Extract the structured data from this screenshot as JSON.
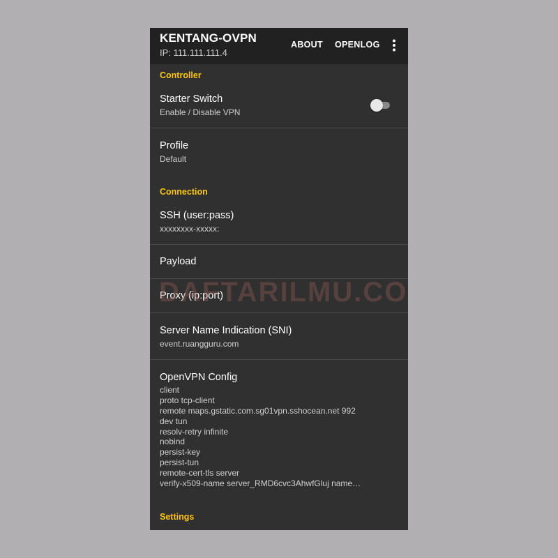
{
  "appbar": {
    "title": "KENTANG-OVPN",
    "subtitle": "IP: 111.111.111.4",
    "actions": {
      "about": "ABOUT",
      "openlog": "OPENLOG"
    },
    "overflow_icon": "more-vert-icon"
  },
  "sections": {
    "controller": "Controller",
    "connection": "Connection",
    "settings": "Settings"
  },
  "items": {
    "starter": {
      "label": "Starter Switch",
      "value": "Enable / Disable VPN",
      "enabled": false
    },
    "profile": {
      "label": "Profile",
      "value": "Default"
    },
    "ssh": {
      "label": "SSH (user:pass)",
      "value": "xxxxxxxx-xxxxx:"
    },
    "payload": {
      "label": "Payload"
    },
    "proxy": {
      "label": "Proxy (ip:port)"
    },
    "sni": {
      "label": "Server Name Indication (SNI)",
      "value": "event.ruangguru.com"
    },
    "openvpn": {
      "label": "OpenVPN Config",
      "lines": [
        "client",
        "proto tcp-client",
        "remote maps.gstatic.com.sg01vpn.sshocean.net 992",
        "dev tun",
        "resolv-retry infinite",
        "nobind",
        "persist-key",
        "persist-tun",
        "remote-cert-tls server",
        "verify-x509-name server_RMD6cvc3AhwfGluj name…"
      ]
    }
  },
  "watermark": "DAFTARILMU.COM",
  "colors": {
    "background": "#b1afb2",
    "appbar": "#212121",
    "surface": "#303030",
    "accent": "#fdc412"
  }
}
